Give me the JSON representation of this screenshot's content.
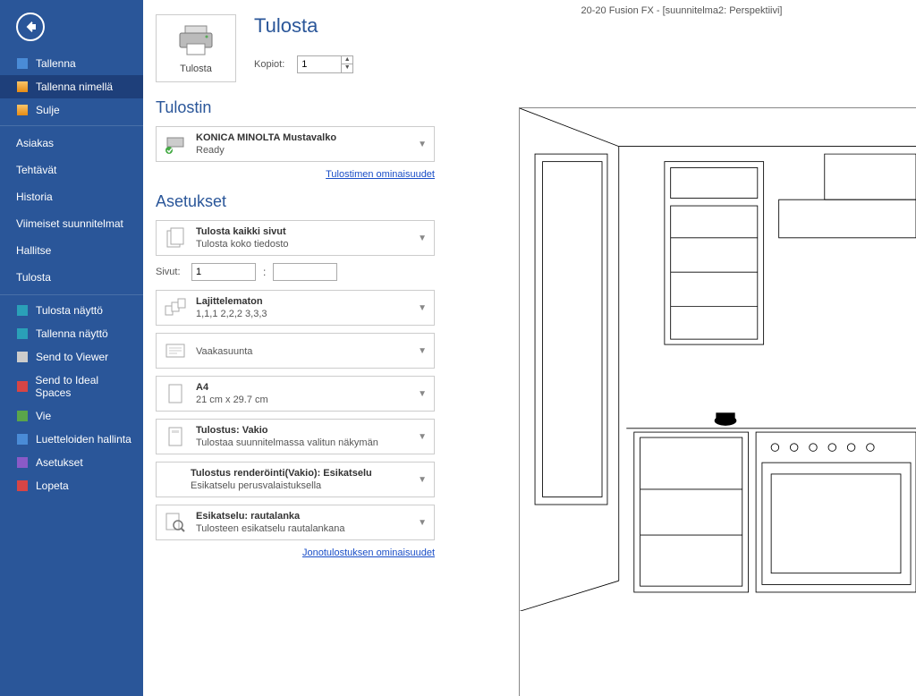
{
  "app_title": "20-20 Fusion FX - [suunnitelma2: Perspektiivi]",
  "sidebar": {
    "items_top": [
      {
        "label": "Tallenna",
        "selected": false
      },
      {
        "label": "Tallenna nimellä",
        "selected": true
      },
      {
        "label": "Sulje",
        "selected": false
      }
    ],
    "items_plain": [
      {
        "label": "Asiakas"
      },
      {
        "label": "Tehtävät"
      },
      {
        "label": "Historia"
      },
      {
        "label": "Viimeiset suunnitelmat"
      },
      {
        "label": "Hallitse"
      },
      {
        "label": "Tulosta",
        "active": true
      }
    ],
    "items_bottom": [
      {
        "label": "Tulosta näyttö"
      },
      {
        "label": "Tallenna näyttö"
      },
      {
        "label": "Send to Viewer"
      },
      {
        "label": "Send to Ideal Spaces"
      },
      {
        "label": "Vie"
      },
      {
        "label": "Luetteloiden hallinta"
      },
      {
        "label": "Asetukset"
      },
      {
        "label": "Lopeta"
      }
    ]
  },
  "print": {
    "button_label": "Tulosta",
    "title": "Tulosta",
    "copies_label": "Kopiot:",
    "copies_value": "1"
  },
  "printer": {
    "heading": "Tulostin",
    "name": "KONICA MINOLTA Mustavalko",
    "status": "Ready",
    "properties_link": "Tulostimen ominaisuudet"
  },
  "settings": {
    "heading": "Asetukset",
    "print_all": {
      "title": "Tulosta kaikki sivut",
      "sub": "Tulosta koko tiedosto"
    },
    "pages_label": "Sivut:",
    "pages_from": "1",
    "pages_to": "",
    "collate": {
      "title": "Lajittelematon",
      "sub": "1,1,1  2,2,2  3,3,3"
    },
    "orientation": {
      "title": "Vaakasuunta"
    },
    "size": {
      "title": "A4",
      "sub": "21 cm x 29.7 cm"
    },
    "output": {
      "title": "Tulostus: Vakio",
      "sub": "Tulostaa suunnitelmassa valitun näkymän"
    },
    "render": {
      "title": "Tulostus renderöinti(Vakio): Esikatselu",
      "sub": "Esikatselu perusvalaistuksella"
    },
    "preview": {
      "title": "Esikatselu: rautalanka",
      "sub": "Tulosteen esikatselu rautalankana"
    },
    "queue_link": "Jonotulostuksen ominaisuudet"
  }
}
